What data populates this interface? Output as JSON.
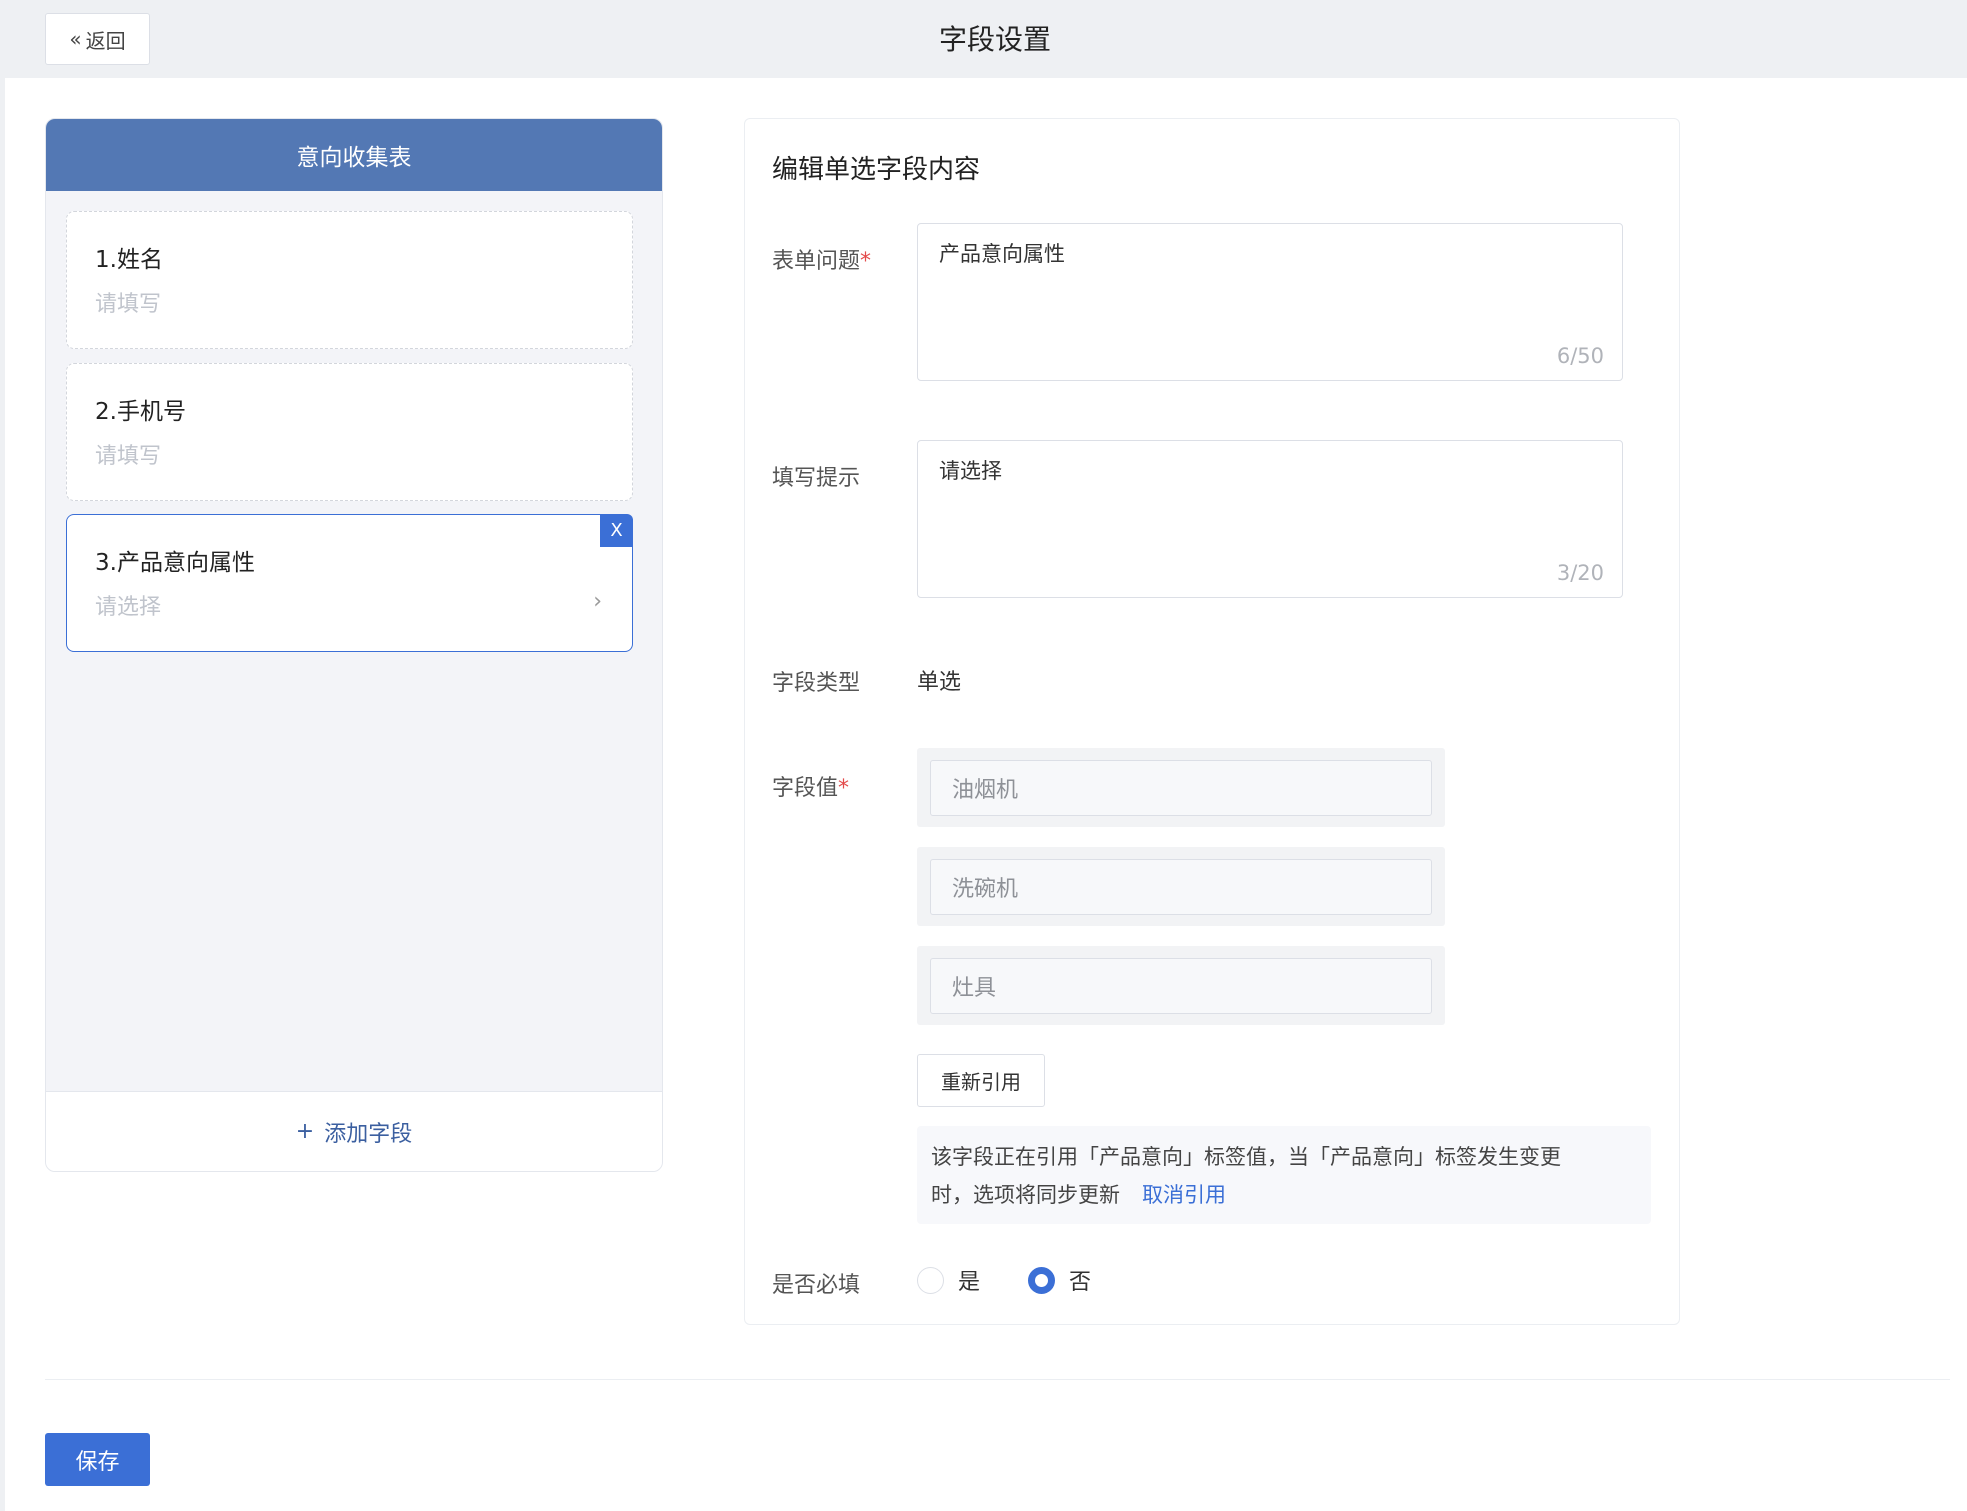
{
  "header": {
    "back_label": "返回",
    "title": "字段设置"
  },
  "preview": {
    "form_title": "意向收集表",
    "fields": [
      {
        "title": "1.姓名",
        "placeholder": "请填写"
      },
      {
        "title": "2.手机号",
        "placeholder": "请填写"
      },
      {
        "title": "3.产品意向属性",
        "placeholder": "请选择"
      }
    ],
    "delete_label": "X",
    "add_field_label": "添加字段"
  },
  "editor": {
    "title": "编辑单选字段内容",
    "question_label": "表单问题",
    "question_value": "产品意向属性",
    "question_count": "6/50",
    "hint_label": "填写提示",
    "hint_value": "请选择",
    "hint_count": "3/20",
    "type_label": "字段类型",
    "type_value": "单选",
    "values_label": "字段值",
    "options": [
      "油烟机",
      "洗碗机",
      "灶具"
    ],
    "re_reference_label": "重新引用",
    "notice_line1": "该字段正在引用「产品意向」标签值，当「产品意向」标签发生变更",
    "notice_line2": "时，选项将同步更新",
    "cancel_reference_label": "取消引用",
    "required_label": "是否必填",
    "required_yes": "是",
    "required_no": "否",
    "required_selected": "否"
  },
  "footer": {
    "save_label": "保存"
  },
  "colors": {
    "primary": "#3b6fd6",
    "header_blue": "#5378b4",
    "required_star": "#e34b4b"
  }
}
